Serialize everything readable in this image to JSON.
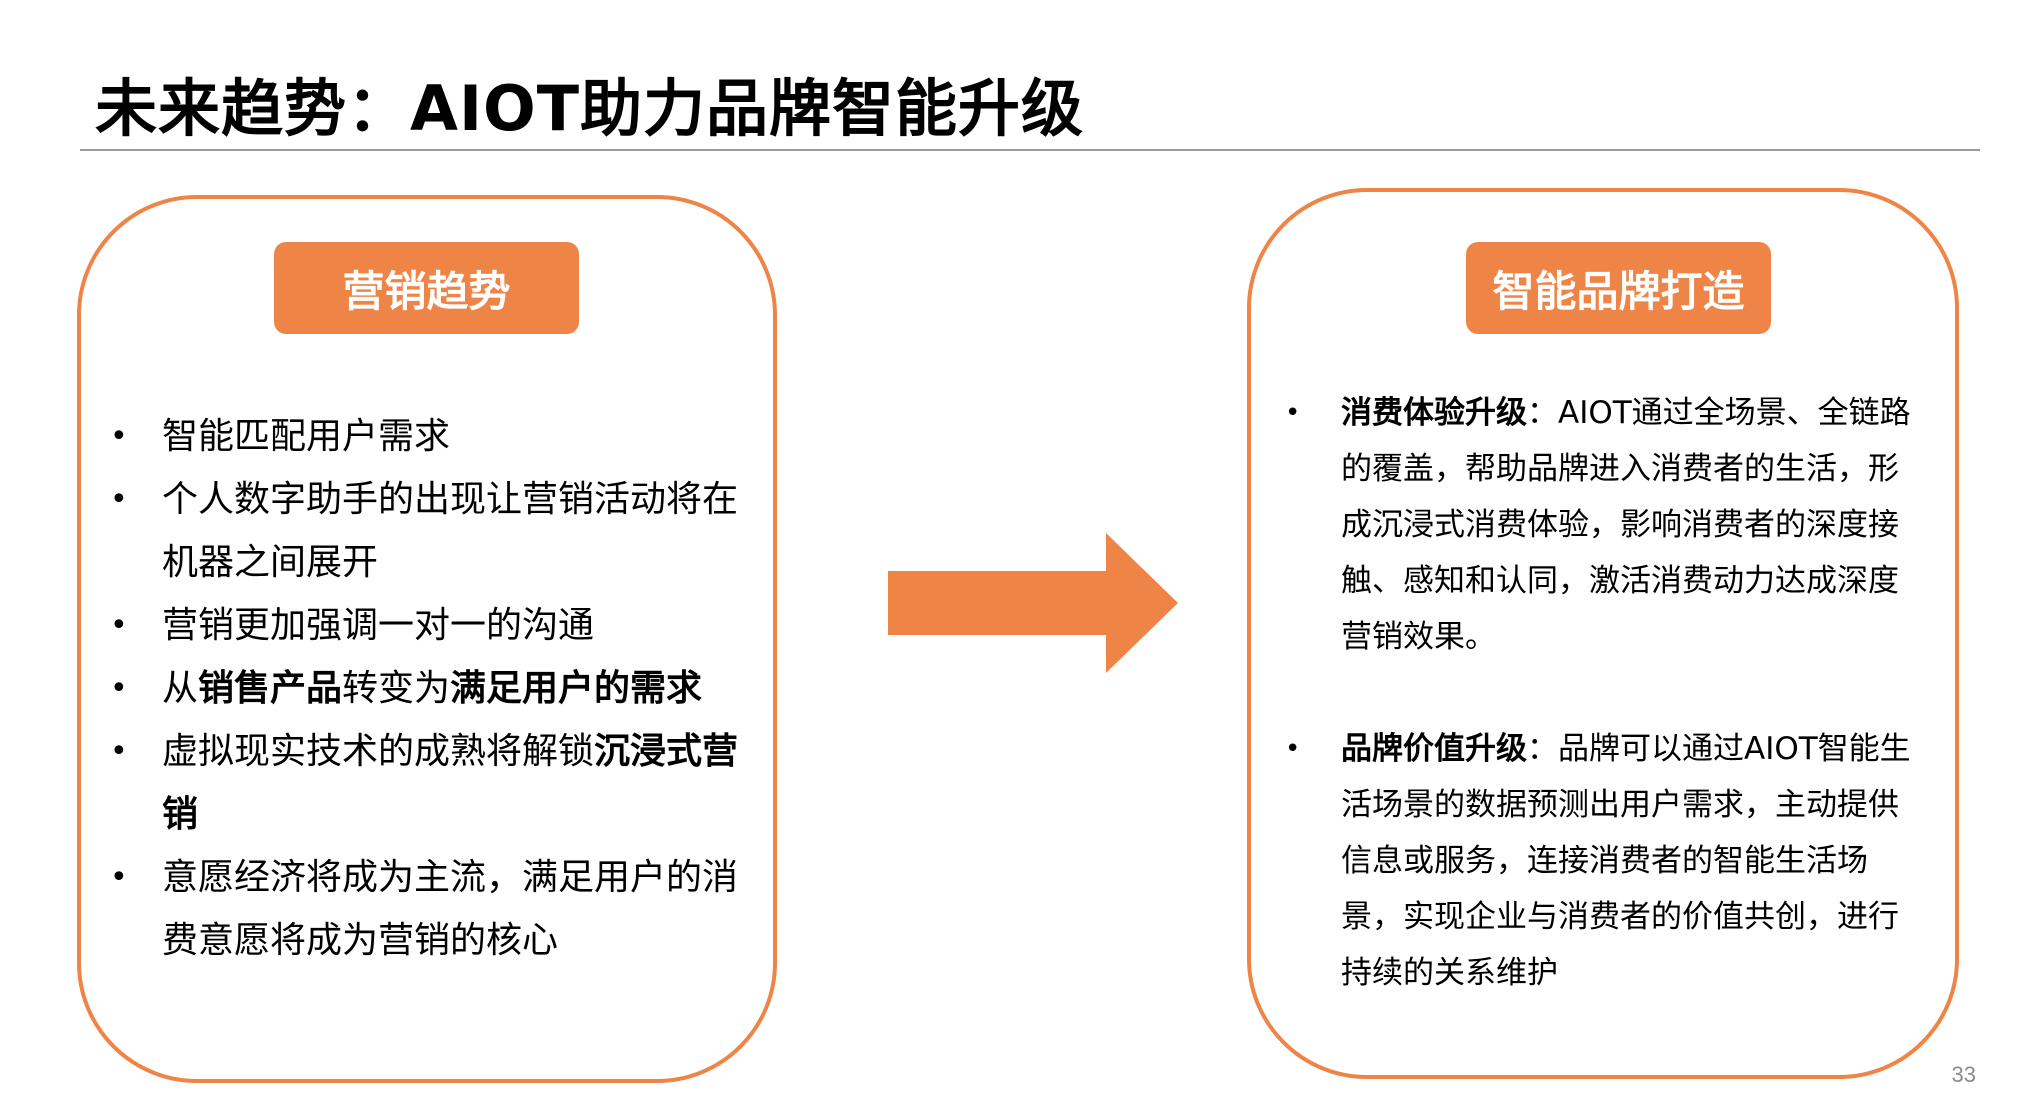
{
  "slide": {
    "title": "未来趋势：AIOT助力品牌智能升级",
    "page_number": "33",
    "accent_color": "#ee8446"
  },
  "left_panel": {
    "header": "营销趋势",
    "bullet_symbol": "•",
    "items": [
      {
        "parts": [
          "智能匹配用户需求"
        ]
      },
      {
        "parts": [
          "个人数字助手的出现让营销活动将在机器之间展开"
        ]
      },
      {
        "parts": [
          "营销更加强调一对一的沟通"
        ]
      },
      {
        "parts": [
          "从",
          "销售产品",
          "转变为",
          "满足用户的需求"
        ]
      },
      {
        "parts": [
          "虚拟现实技术的成熟将解锁",
          "沉浸式营销"
        ]
      },
      {
        "parts": [
          "意愿经济将成为主流，满足用户的消费意愿将成为营销的核心"
        ]
      }
    ]
  },
  "arrow": {
    "icon": "right-arrow-icon"
  },
  "right_panel": {
    "header": "智能品牌打造",
    "bullet_symbol": "•",
    "items": [
      {
        "label": "消费体验升级",
        "text": "：AIOT通过全场景、全链路的覆盖，帮助品牌进入消费者的生活，形成沉浸式消费体验，影响消费者的深度接触、感知和认同，激活消费动力达成深度营销效果。"
      },
      {
        "label": "品牌价值升级",
        "text": "：品牌可以通过AIOT智能生活场景的数据预测出用户需求，主动提供信息或服务，连接消费者的智能生活场景，实现企业与消费者的价值共创，进行持续的关系维护"
      }
    ]
  }
}
